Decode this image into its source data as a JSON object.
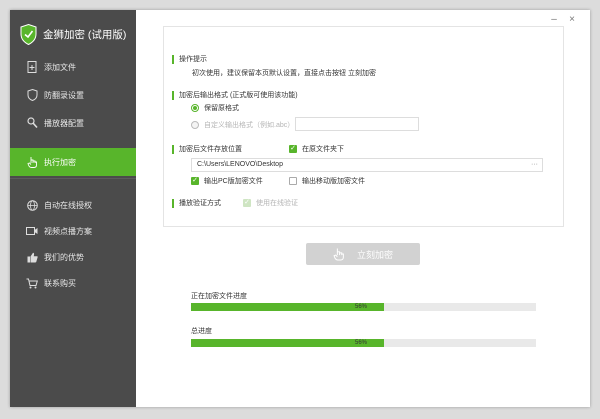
{
  "app": {
    "title": "金狮加密 (试用版)"
  },
  "colors": {
    "accent": "#58b52b",
    "sidebar": "#4b4b4b",
    "active": "#58b52b"
  },
  "window_controls": {
    "minimize": "–",
    "close": "×"
  },
  "sidebar": {
    "items": [
      {
        "label": "添加文件",
        "icon": "file-add-icon"
      },
      {
        "label": "防翻录设置",
        "icon": "shield-icon"
      },
      {
        "label": "播放器配置",
        "icon": "wrench-icon"
      },
      {
        "label": "执行加密",
        "icon": "hand-pointer-icon",
        "active": true
      },
      {
        "label": "自动在线授权",
        "icon": "globe-icon"
      },
      {
        "label": "视频点播方案",
        "icon": "video-icon"
      },
      {
        "label": "我们的优势",
        "icon": "thumbs-up-icon"
      },
      {
        "label": "联系购买",
        "icon": "cart-icon"
      }
    ]
  },
  "settings": {
    "tip_title": "操作提示",
    "tip_text": "初次使用，建议保留本页默认设置，直接点击按钮 立刻加密",
    "output_format_title": "加密后输出格式 (正式版可使用该功能)",
    "radio_original": "保留原格式",
    "radio_custom": "自定义输出格式（例如.abc）",
    "custom_format_value": "",
    "location_title": "加密后文件存放位置",
    "same_folder_label": "在原文件夹下",
    "path_value": "C:\\Users\\LENOVO\\Desktop",
    "browse_label": "···",
    "output_pc_label": "输出PC版加密文件",
    "output_mobile_label": "输出移动版加密文件",
    "verify_title": "播放验证方式",
    "online_verify_label": "使用在线验证"
  },
  "action": {
    "encrypt_button": "立刻加密"
  },
  "progress": {
    "current_label": "正在加密文件进度",
    "current_value": 56,
    "current_text": "56%",
    "total_label": "总进度",
    "total_value": 56,
    "total_text": "56%"
  }
}
